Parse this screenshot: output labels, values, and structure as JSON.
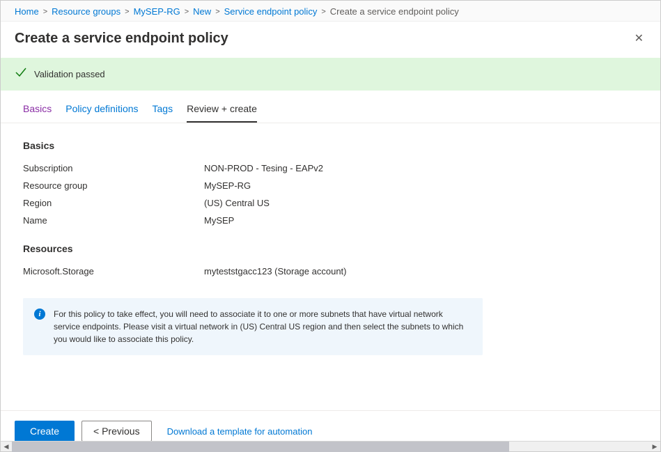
{
  "breadcrumb": {
    "items": [
      {
        "label": "Home"
      },
      {
        "label": "Resource groups"
      },
      {
        "label": "MySEP-RG"
      },
      {
        "label": "New"
      },
      {
        "label": "Service endpoint policy"
      }
    ],
    "current": "Create a service endpoint policy"
  },
  "header": {
    "title": "Create a service endpoint policy"
  },
  "validation": {
    "message": "Validation passed"
  },
  "tabs": {
    "basics": "Basics",
    "policy_definitions": "Policy definitions",
    "tags": "Tags",
    "review_create": "Review + create"
  },
  "sections": {
    "basics": {
      "title": "Basics",
      "rows": {
        "subscription": {
          "key": "Subscription",
          "val": "NON-PROD - Tesing - EAPv2"
        },
        "resource_group": {
          "key": "Resource group",
          "val": "MySEP-RG"
        },
        "region": {
          "key": "Region",
          "val": "(US) Central US"
        },
        "name": {
          "key": "Name",
          "val": "MySEP"
        }
      }
    },
    "resources": {
      "title": "Resources",
      "rows": {
        "storage": {
          "key": "Microsoft.Storage",
          "val": "myteststgacc123 (Storage account)"
        }
      }
    }
  },
  "info": {
    "text": "For this policy to take effect, you will need to associate it to one or more subnets that have virtual network service endpoints. Please visit a virtual network in (US) Central US region and then select the subnets to which you would like to associate this policy."
  },
  "footer": {
    "create": "Create",
    "previous": "<  Previous",
    "download": "Download a template for automation"
  }
}
